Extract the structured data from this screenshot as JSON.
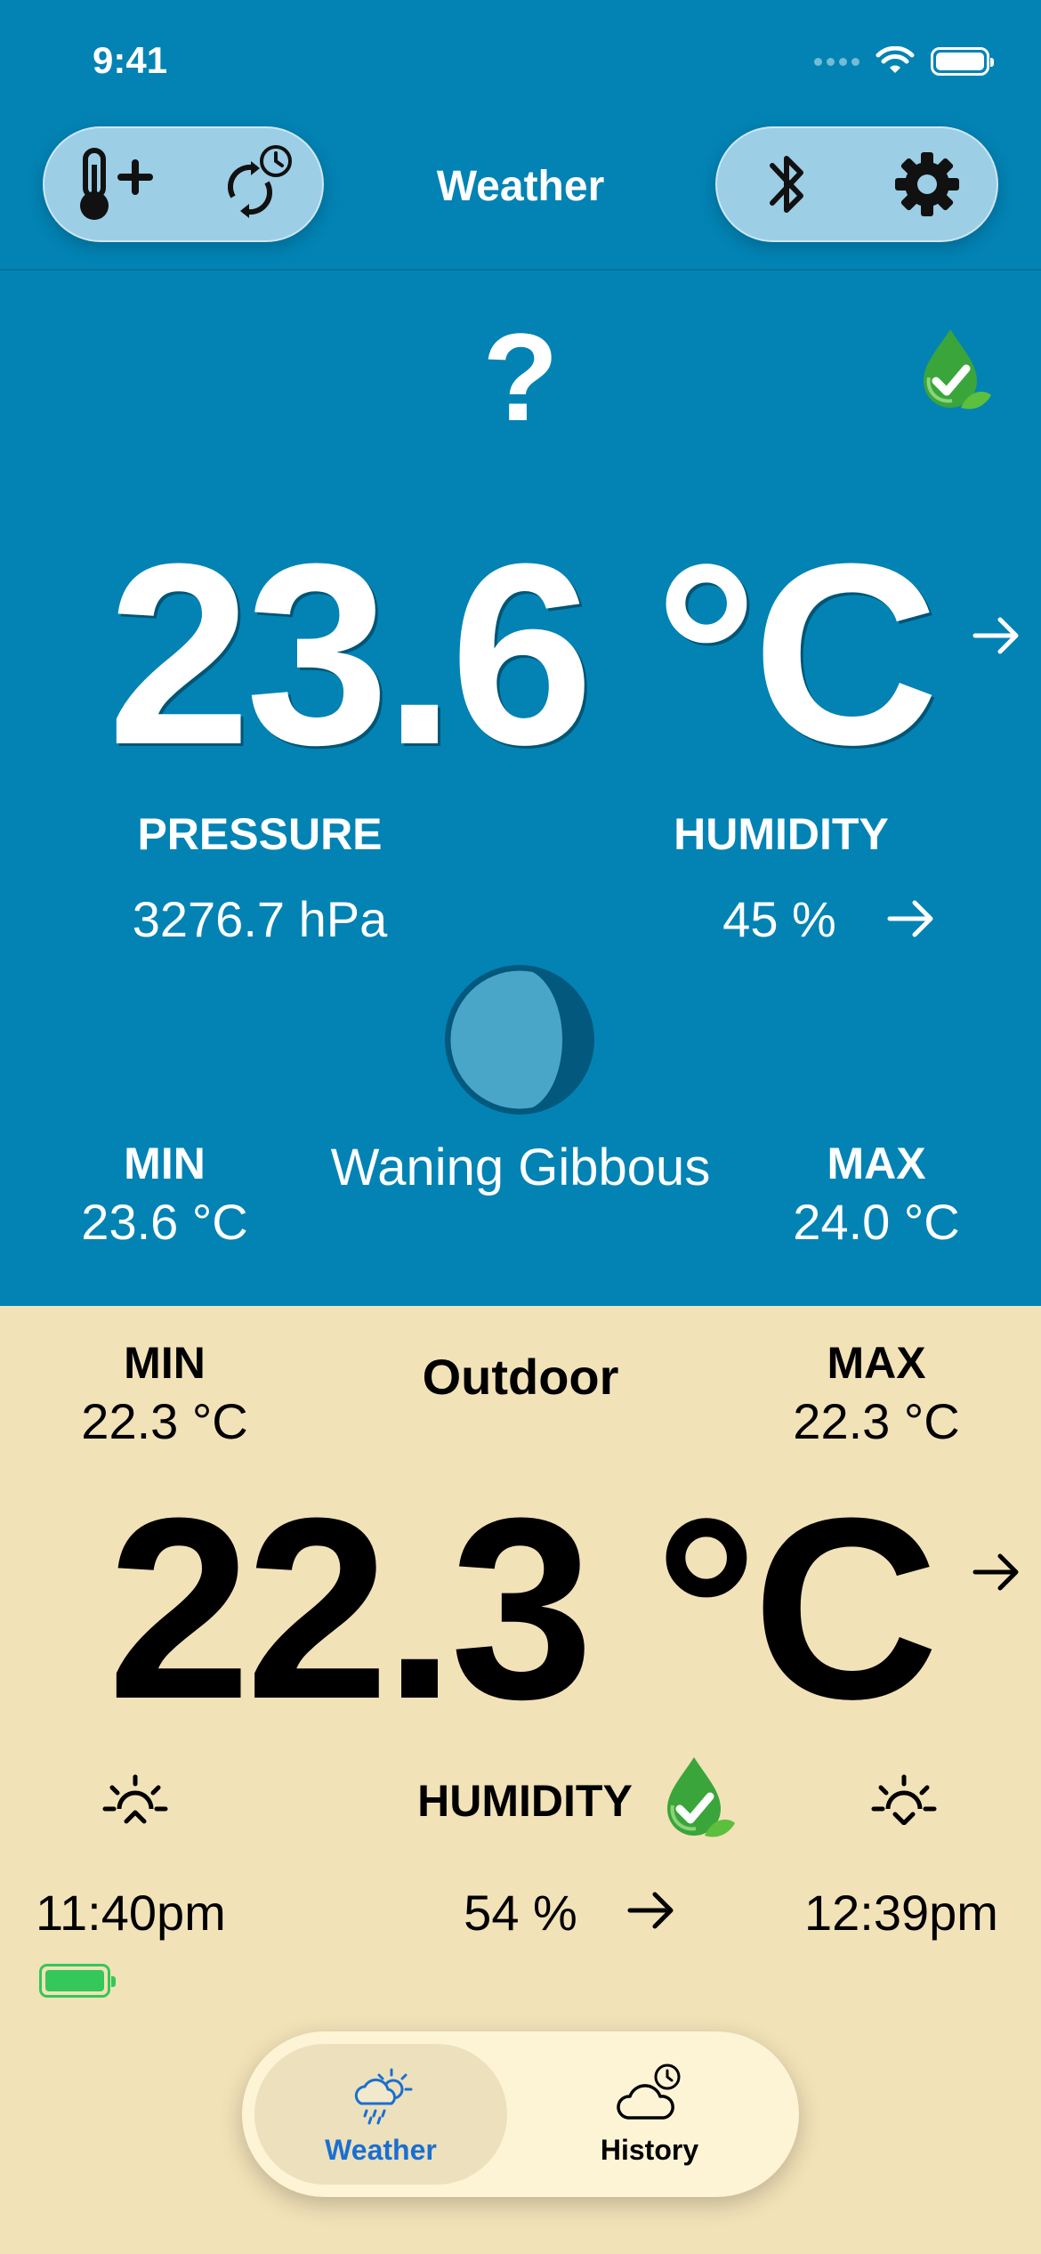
{
  "status_bar": {
    "time": "9:41"
  },
  "nav": {
    "title": "Weather"
  },
  "indoor": {
    "status_symbol": "?",
    "temperature": "23.6 °C",
    "pressure_label": "PRESSURE",
    "pressure_value": "3276.7 hPa",
    "humidity_label": "HUMIDITY",
    "humidity_value": "45 %",
    "moon_phase": "Waning Gibbous",
    "min_label": "MIN",
    "min_value": "23.6 °C",
    "max_label": "MAX",
    "max_value": "24.0 °C"
  },
  "outdoor": {
    "title": "Outdoor",
    "min_label": "MIN",
    "min_value": "22.3 °C",
    "max_label": "MAX",
    "max_value": "22.3 °C",
    "temperature": "22.3 °C",
    "humidity_label": "HUMIDITY",
    "humidity_value": "54 %",
    "sunset_time": "11:40pm",
    "sunrise_time": "12:39pm"
  },
  "tab_bar": {
    "tabs": [
      {
        "label": "Weather",
        "active": true
      },
      {
        "label": "History",
        "active": false
      }
    ]
  },
  "icons": {
    "nav_left": [
      "thermometer-plus-icon",
      "sync-clock-icon"
    ],
    "nav_right": [
      "bluetooth-icon",
      "gear-icon"
    ],
    "status": [
      "cellular-dots-icon",
      "wifi-icon",
      "battery-icon"
    ],
    "indoor": [
      "leaf-drop-check-icon",
      "arrow-right-icon",
      "moon-icon"
    ],
    "outdoor": [
      "sunset-icon",
      "sunrise-icon",
      "leaf-drop-check-icon",
      "battery-icon"
    ]
  },
  "colors": {
    "indoor_bg": "#0283b4",
    "outdoor_bg": "#f2e2b8",
    "accent_blue": "#1a6fd0",
    "battery_green": "#34c759"
  }
}
